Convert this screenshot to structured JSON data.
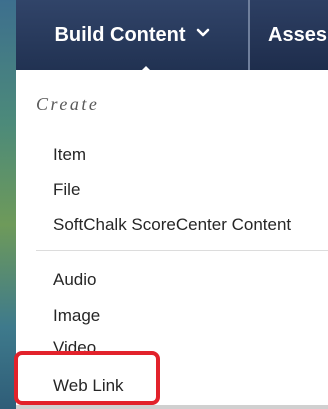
{
  "tabs": {
    "build_content": {
      "label": "Build Content",
      "chevron": "⌄"
    },
    "assessments": {
      "label": "Asses"
    }
  },
  "menu": {
    "heading": "Create",
    "group1": [
      "Item",
      "File",
      "SoftChalk ScoreCenter Content"
    ],
    "group2": [
      "Audio",
      "Image",
      "Video",
      "Web Link"
    ]
  },
  "highlight": {
    "color": "#e2222b",
    "target": "Web Link"
  }
}
